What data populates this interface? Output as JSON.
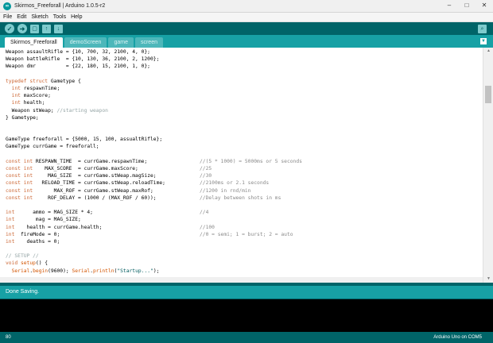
{
  "window": {
    "title": "Skirmos_Freeforall | Arduino 1.0.5-r2",
    "controls": [
      "–",
      "□",
      "✕"
    ]
  },
  "menu": [
    "File",
    "Edit",
    "Sketch",
    "Tools",
    "Help"
  ],
  "toolbar": {
    "verify": "✓",
    "upload": "➜",
    "new": "▢",
    "open": "↑",
    "save": "↓",
    "serial_monitor": "⌕"
  },
  "tabs": [
    "Skirmos_Freeforall",
    "demoScreen",
    "game",
    "screen"
  ],
  "tab_menu": "▼",
  "code_lines": [
    {
      "code": "Weapon assaultRifle = {10, 700, 32, 2100, 4, 0};",
      "comment": ""
    },
    {
      "code": "Weapon battleRifle  = {10, 130, 36, 2100, 2, 1200};",
      "comment": ""
    },
    {
      "code": "Weapon dmr          = {22, 180, 15, 2100, 1, 0};",
      "comment": ""
    },
    {
      "code": "",
      "comment": ""
    },
    {
      "code": "typedef struct Gametype {",
      "comment": ""
    },
    {
      "code": "  int respawnTime;",
      "comment": ""
    },
    {
      "code": "  int maxScore;",
      "comment": ""
    },
    {
      "code": "  int health;",
      "comment": ""
    },
    {
      "code": "  Weapon stWeap; //starting weapon",
      "comment": ""
    },
    {
      "code": "} Gametype;",
      "comment": ""
    },
    {
      "code": "",
      "comment": ""
    },
    {
      "code": "",
      "comment": ""
    },
    {
      "code": "GameType freeforall = {5000, 15, 100, assualtRifle};",
      "comment": ""
    },
    {
      "code": "GameType currGame = freeforall;",
      "comment": ""
    },
    {
      "code": "",
      "comment": ""
    },
    {
      "code": "const int RESPAWN_TIME  = currGame.respawnTime;",
      "comment": "//(5 * 1000) = 5000ms or 5 seconds"
    },
    {
      "code": "const int    MAX_SCORE  = currGame.maxScore;",
      "comment": "//25"
    },
    {
      "code": "const int     MAG_SIZE  = currGame.stWeap.magSize;",
      "comment": "//30"
    },
    {
      "code": "const int   RELOAD_TIME = currGame.stWeap.reloadTime;",
      "comment": "//2100ms or 2.1 seconds"
    },
    {
      "code": "const int       MAX_ROF = currGame.stWeap.maxRof;",
      "comment": "//1200 in rnd/min"
    },
    {
      "code": "const int     ROF_DELAY = (1000 / (MAX_ROF / 60));",
      "comment": "//Delay between shots in ms"
    },
    {
      "code": "",
      "comment": ""
    },
    {
      "code": "int      ammo = MAG_SIZE * 4;",
      "comment": "//4"
    },
    {
      "code": "int       mag = MAG_SIZE;",
      "comment": ""
    },
    {
      "code": "int    health = currGame.health;",
      "comment": "//100"
    },
    {
      "code": "int  fireMode = 0;",
      "comment": "//0 = semi; 1 = burst; 2 = auto"
    },
    {
      "code": "int    deaths = 0;",
      "comment": ""
    },
    {
      "code": "",
      "comment": ""
    },
    {
      "code": "// SETUP //",
      "comment": ""
    },
    {
      "code": "void setup() {",
      "comment": ""
    },
    {
      "code": "  Serial.begin(9600); Serial.println(\"Startup...\");",
      "comment": ""
    }
  ],
  "status": {
    "message": "Done Saving."
  },
  "footer": {
    "line_number": "80",
    "board": "Arduino Uno on COM5"
  },
  "colors": {
    "teal_dark": "#006468",
    "teal": "#17a1a5",
    "keyword": "#cc6633",
    "comment": "#95a5a6"
  }
}
